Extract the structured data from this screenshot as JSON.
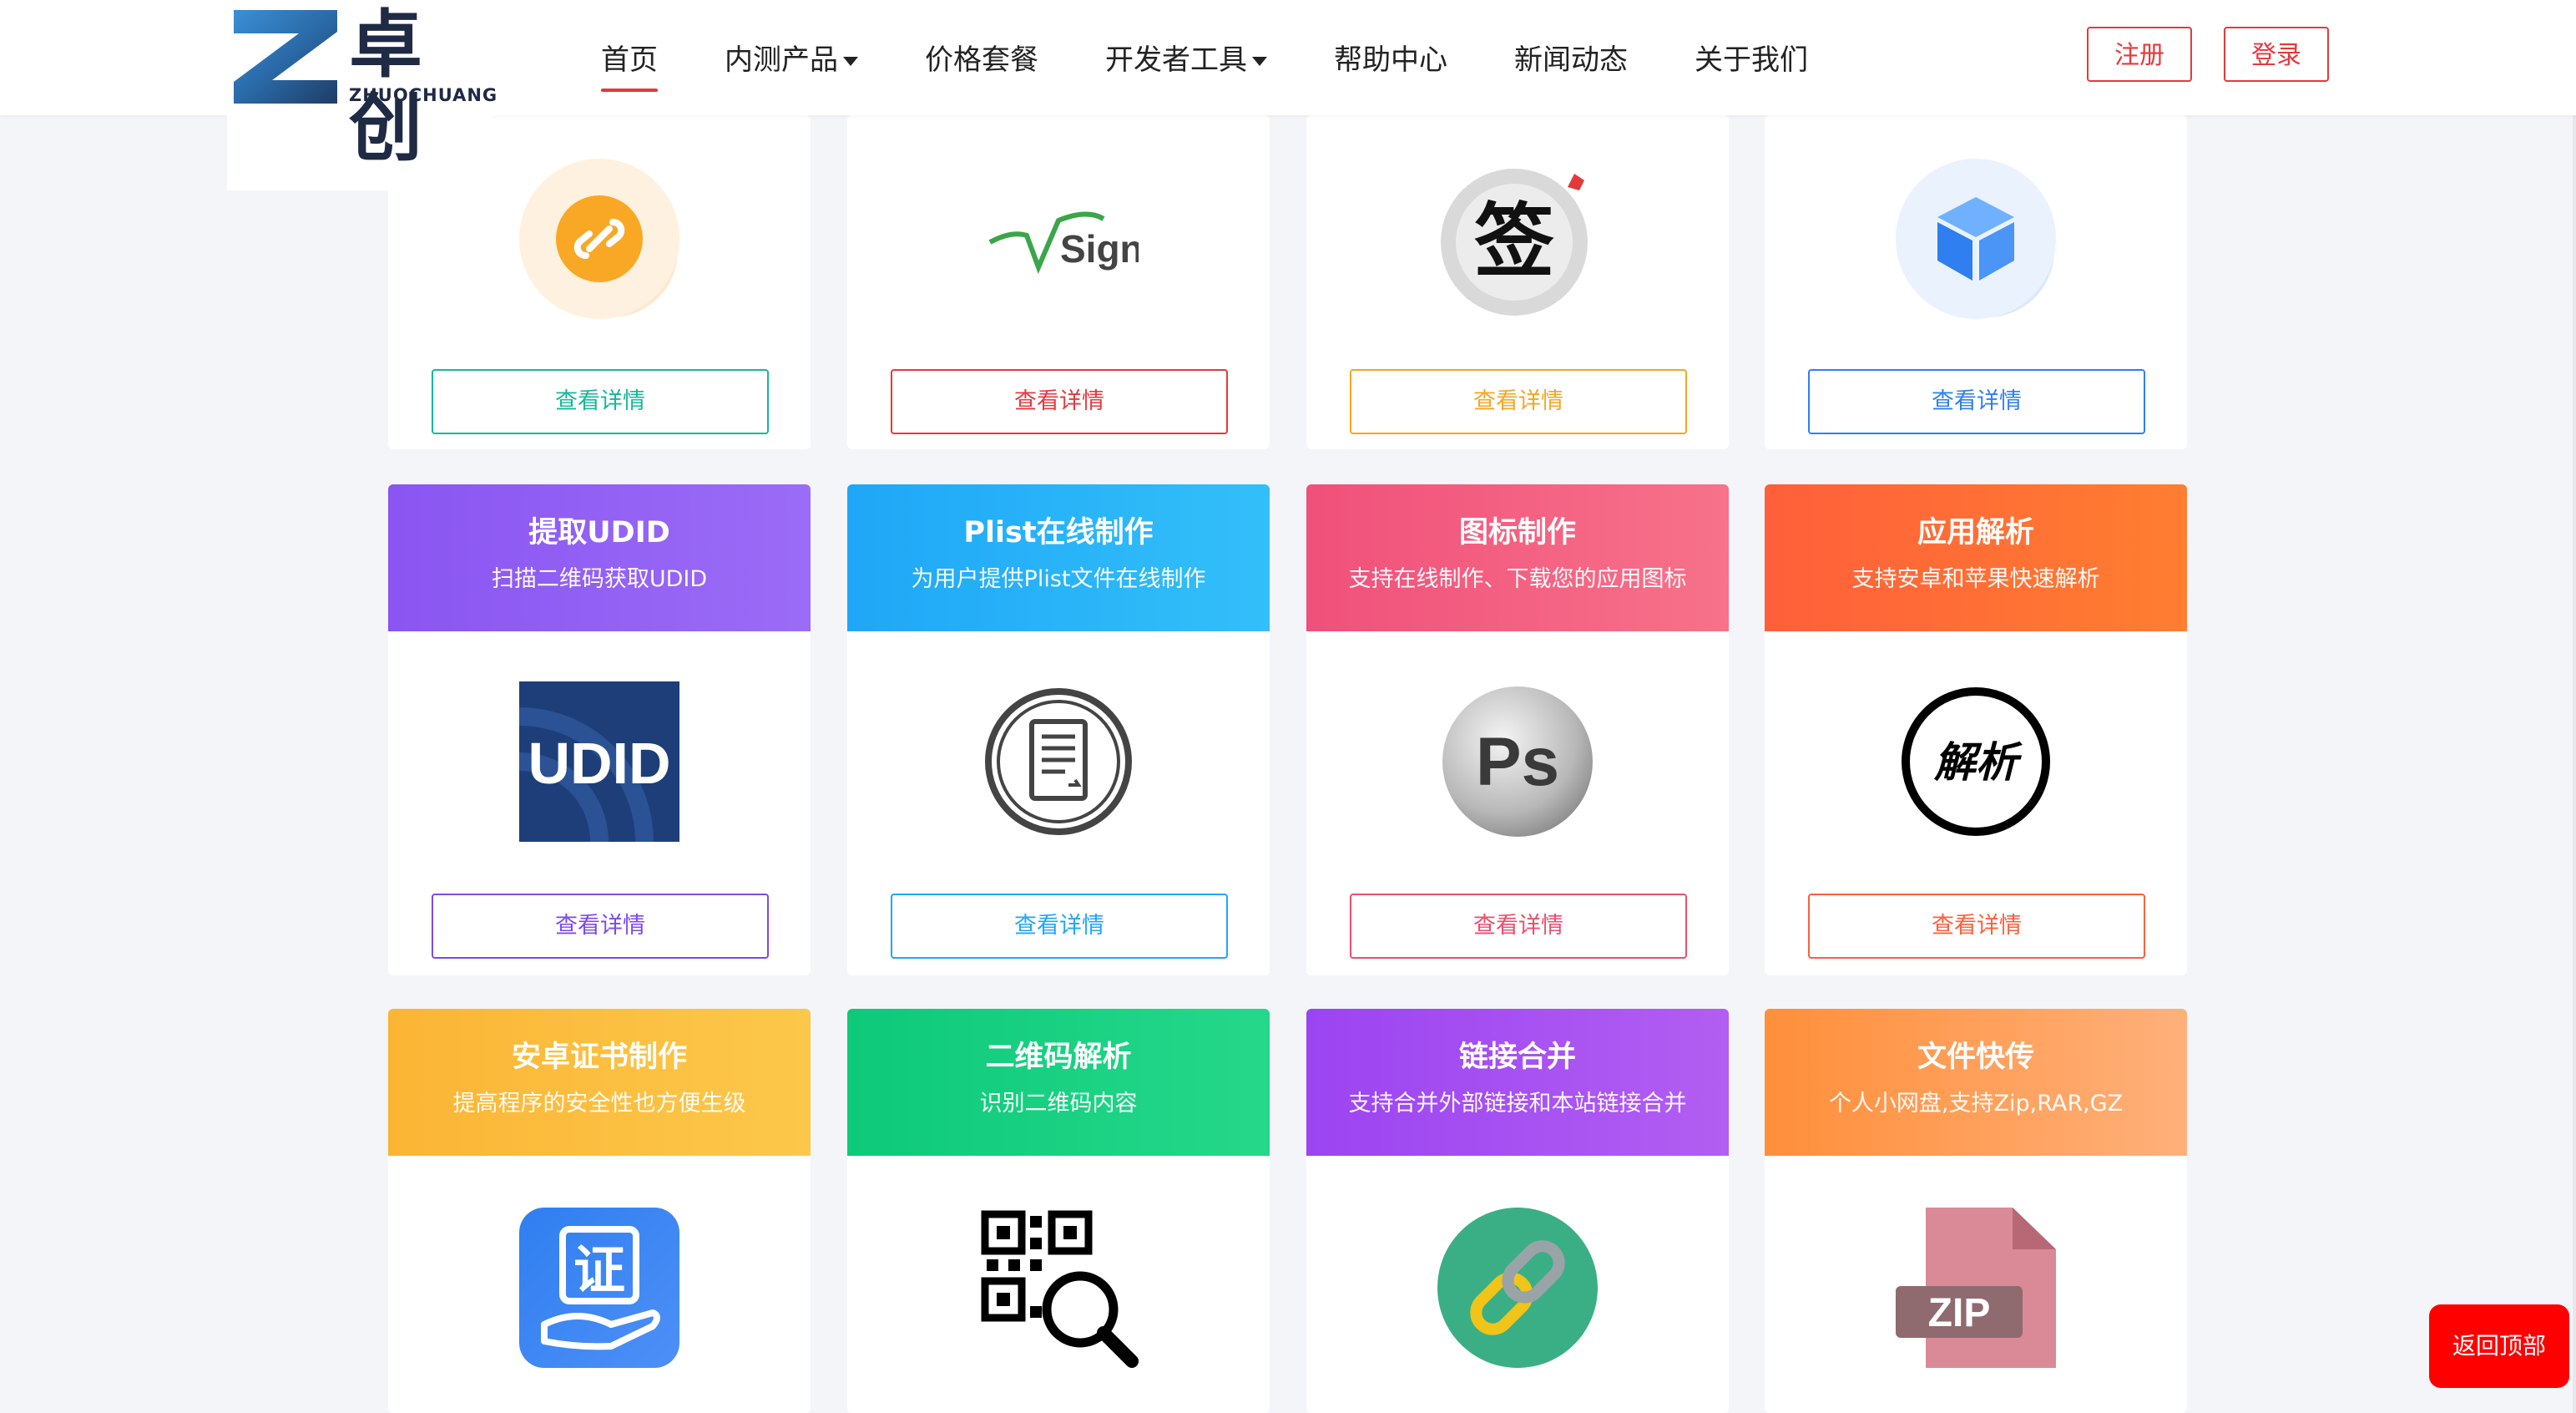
{
  "brand": {
    "name_cn": "卓创",
    "name_en": "ZHUOCHUANG",
    "mark_letter": "Z"
  },
  "nav": [
    {
      "label": "首页",
      "active": true,
      "dropdown": false
    },
    {
      "label": "内测产品",
      "active": false,
      "dropdown": true
    },
    {
      "label": "价格套餐",
      "active": false,
      "dropdown": false
    },
    {
      "label": "开发者工具",
      "active": false,
      "dropdown": true
    },
    {
      "label": "帮助中心",
      "active": false,
      "dropdown": false
    },
    {
      "label": "新闻动态",
      "active": false,
      "dropdown": false
    },
    {
      "label": "关于我们",
      "active": false,
      "dropdown": false
    }
  ],
  "auth": {
    "register": "注册",
    "login": "登录"
  },
  "detail_label": "查看详情",
  "cards_top": [
    {
      "icon": "mini-program-link-icon",
      "accent": "#16b89a"
    },
    {
      "icon": "vpsign-logo-icon",
      "logo_text": "VPSign",
      "accent": "#e4393c"
    },
    {
      "icon": "sign-brush-icon",
      "logo_text": "签",
      "accent": "#f5a623"
    },
    {
      "icon": "cube-icon",
      "accent": "#2f7ff0"
    }
  ],
  "cards_mid": [
    {
      "title": "提取UDID",
      "desc": "扫描二维码获取UDID",
      "icon": "udid-icon",
      "icon_text": "UDID",
      "grad": [
        "#8a55f2",
        "#9b6cf6"
      ],
      "accent": "#7d4ae8"
    },
    {
      "title": "Plist在线制作",
      "desc": "为用户提供Plist文件在线制作",
      "icon": "plist-document-icon",
      "grad": [
        "#1fa7f7",
        "#33bff9"
      ],
      "accent": "#1fa7f7"
    },
    {
      "title": "图标制作",
      "desc": "支持在线制作、下载您的应用图标",
      "icon": "photoshop-icon",
      "icon_text": "Ps",
      "grad": [
        "#f0507a",
        "#f7728a"
      ],
      "accent": "#ee4d6d"
    },
    {
      "title": "应用解析",
      "desc": "支持安卓和苹果快速解析",
      "icon": "parse-icon",
      "icon_text": "解析",
      "grad": [
        "#ff5f3a",
        "#ff7e30"
      ],
      "accent": "#ff5f3a"
    }
  ],
  "cards_bottom": [
    {
      "title": "安卓证书制作",
      "desc": "提高程序的安全性也方便生级",
      "icon": "certificate-icon",
      "icon_text": "证",
      "grad": [
        "#fbb535",
        "#fcc84a"
      ],
      "accent": "#fbb535"
    },
    {
      "title": "二维码解析",
      "desc": "识别二维码内容",
      "icon": "qrcode-search-icon",
      "grad": [
        "#0ec97a",
        "#25d88a"
      ],
      "accent": "#0ec97a"
    },
    {
      "title": "链接合并",
      "desc": "支持合并外部链接和本站链接合并",
      "icon": "chain-link-icon",
      "grad": [
        "#9b44f2",
        "#b25ef2"
      ],
      "accent": "#9b44f2"
    },
    {
      "title": "文件快传",
      "desc": "个人小网盘,支持Zip,RAR,GZ",
      "icon": "zip-file-icon",
      "icon_text": "ZIP",
      "grad": [
        "#ff8f3a",
        "#ffb07a"
      ],
      "accent": "#ff8f3a"
    }
  ],
  "back_to_top": "返回顶部"
}
